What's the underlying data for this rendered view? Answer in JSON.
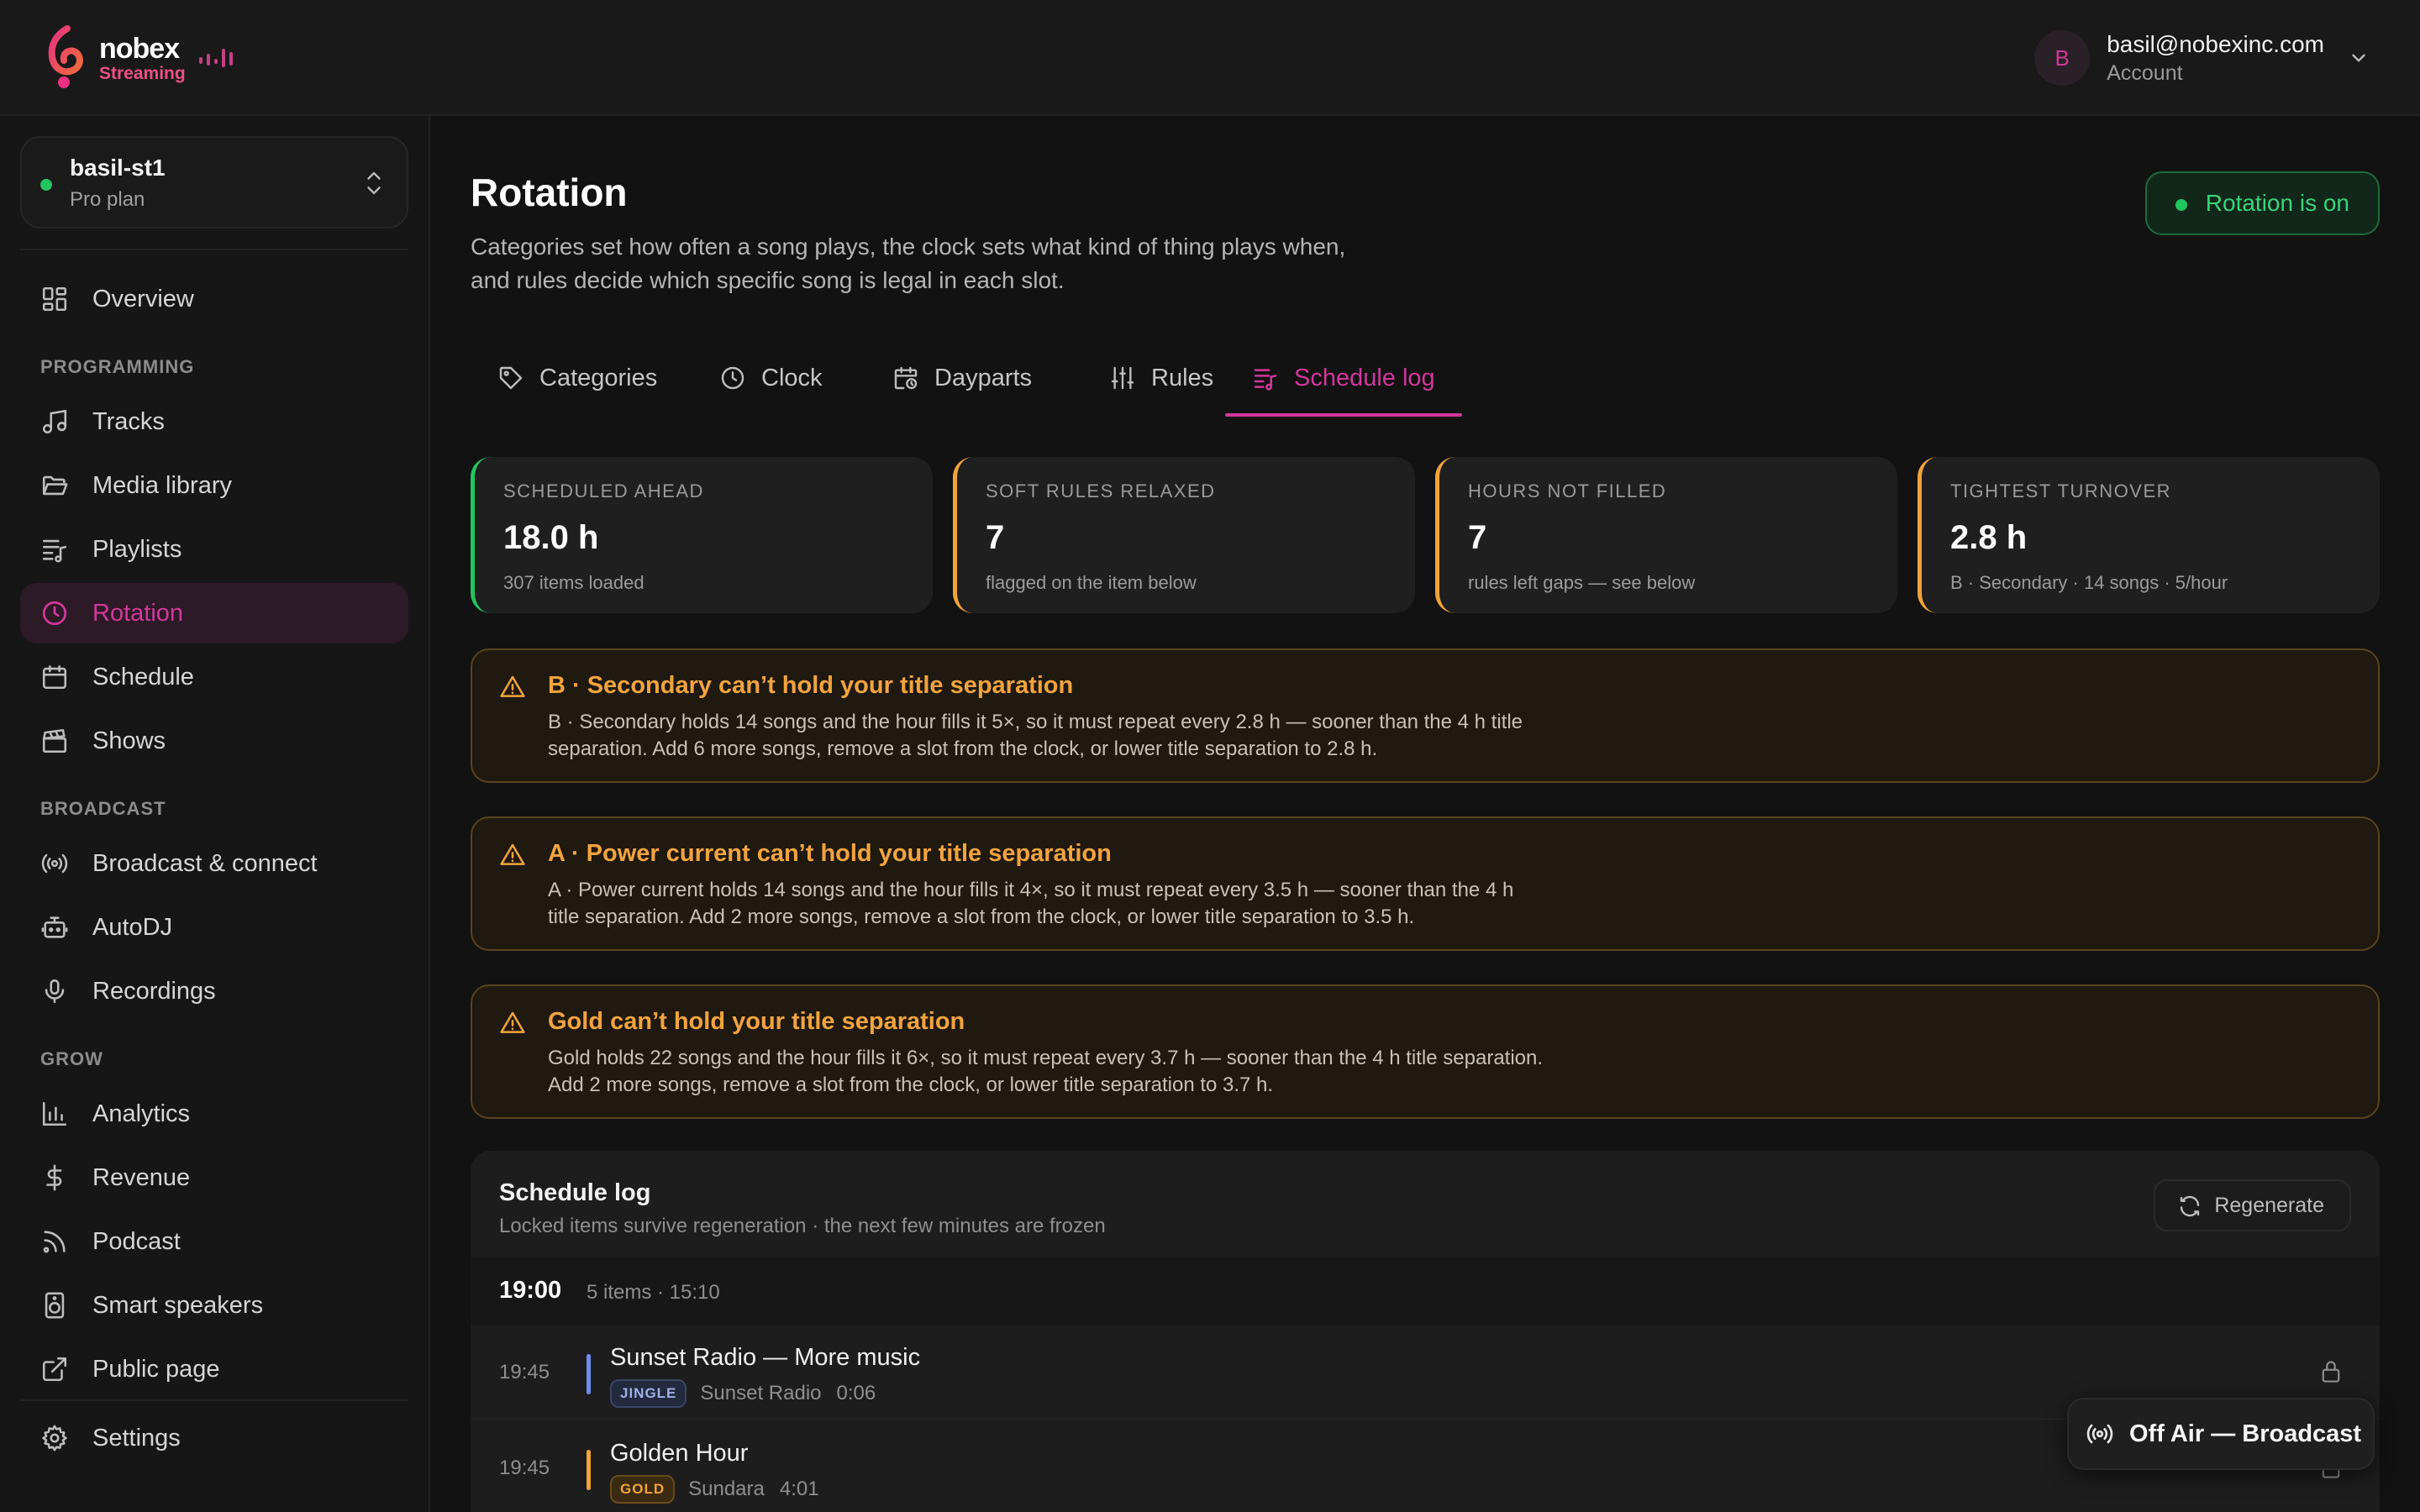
{
  "brand": {
    "name": "nobex",
    "sub": "Streaming",
    "accent": "#d2379c"
  },
  "account": {
    "initial": "B",
    "email": "basil@nobexinc.com",
    "label": "Account"
  },
  "station": {
    "name": "basil-st1",
    "plan": "Pro plan",
    "status_color": "#22c55e"
  },
  "nav": {
    "overview": "Overview",
    "section_programming": "PROGRAMMING",
    "tracks": "Tracks",
    "media_library": "Media library",
    "playlists": "Playlists",
    "rotation": "Rotation",
    "schedule": "Schedule",
    "shows": "Shows",
    "section_broadcast": "BROADCAST",
    "broadcast_connect": "Broadcast & connect",
    "autodj": "AutoDJ",
    "recordings": "Recordings",
    "section_grow": "GROW",
    "analytics": "Analytics",
    "revenue": "Revenue",
    "podcast": "Podcast",
    "smart_speakers": "Smart speakers",
    "public_page": "Public page",
    "settings": "Settings"
  },
  "page": {
    "title": "Rotation",
    "description": "Categories set how often a song plays, the clock sets what kind of thing plays when, and rules decide which specific song is legal in each slot.",
    "status": "Rotation is on"
  },
  "tabs": [
    {
      "label": "Categories",
      "icon": "tag-icon"
    },
    {
      "label": "Clock",
      "icon": "clock-icon"
    },
    {
      "label": "Dayparts",
      "icon": "calendar-icon"
    },
    {
      "label": "Rules",
      "icon": "sliders-icon"
    },
    {
      "label": "Schedule log",
      "icon": "list-music-icon",
      "active": true
    }
  ],
  "stats": [
    {
      "label": "SCHEDULED AHEAD",
      "value": "18.0 h",
      "sub": "307 items loaded",
      "tone": "ok"
    },
    {
      "label": "SOFT RULES RELAXED",
      "value": "7",
      "sub": "flagged on the item below",
      "tone": "warn"
    },
    {
      "label": "HOURS NOT FILLED",
      "value": "7",
      "sub": "rules left gaps — see below",
      "tone": "warn"
    },
    {
      "label": "TIGHTEST TURNOVER",
      "value": "2.8 h",
      "sub": "B · Secondary · 14 songs · 5/hour",
      "tone": "warn"
    }
  ],
  "alerts": [
    {
      "title": "B · Secondary can’t hold your title separation",
      "body": "B · Secondary holds 14 songs and the hour fills it 5×, so it must repeat every 2.8 h — sooner than the 4 h title separation. Add 6 more songs, remove a slot from the clock, or lower title separation to 2.8 h."
    },
    {
      "title": "A · Power current can’t hold your title separation",
      "body": "A · Power current holds 14 songs and the hour fills it 4×, so it must repeat every 3.5 h — sooner than the 4 h title separation. Add 2 more songs, remove a slot from the clock, or lower title separation to 3.5 h."
    },
    {
      "title": "Gold can’t hold your title separation",
      "body": "Gold holds 22 songs and the hour fills it 6×, so it must repeat every 3.7 h — sooner than the 4 h title separation. Add 2 more songs, remove a slot from the clock, or lower title separation to 3.7 h."
    }
  ],
  "log": {
    "title": "Schedule log",
    "subtitle": "Locked items survive regeneration · the next few minutes are frozen",
    "regenerate": "Regenerate",
    "hour": {
      "time": "19:00",
      "meta": "5 items · 15:10"
    },
    "rows": [
      {
        "time": "19:45",
        "title": "Sunset Radio — More music",
        "badge": "JINGLE",
        "artist": "Sunset Radio",
        "duration": "0:06",
        "color": "#6f8df0"
      },
      {
        "time": "19:45",
        "title": "Golden Hour",
        "badge": "GOLD",
        "artist": "Sundara",
        "duration": "4:01",
        "color": "#f0a43a"
      }
    ]
  },
  "onair": {
    "label": "Off Air — Broadcast"
  }
}
